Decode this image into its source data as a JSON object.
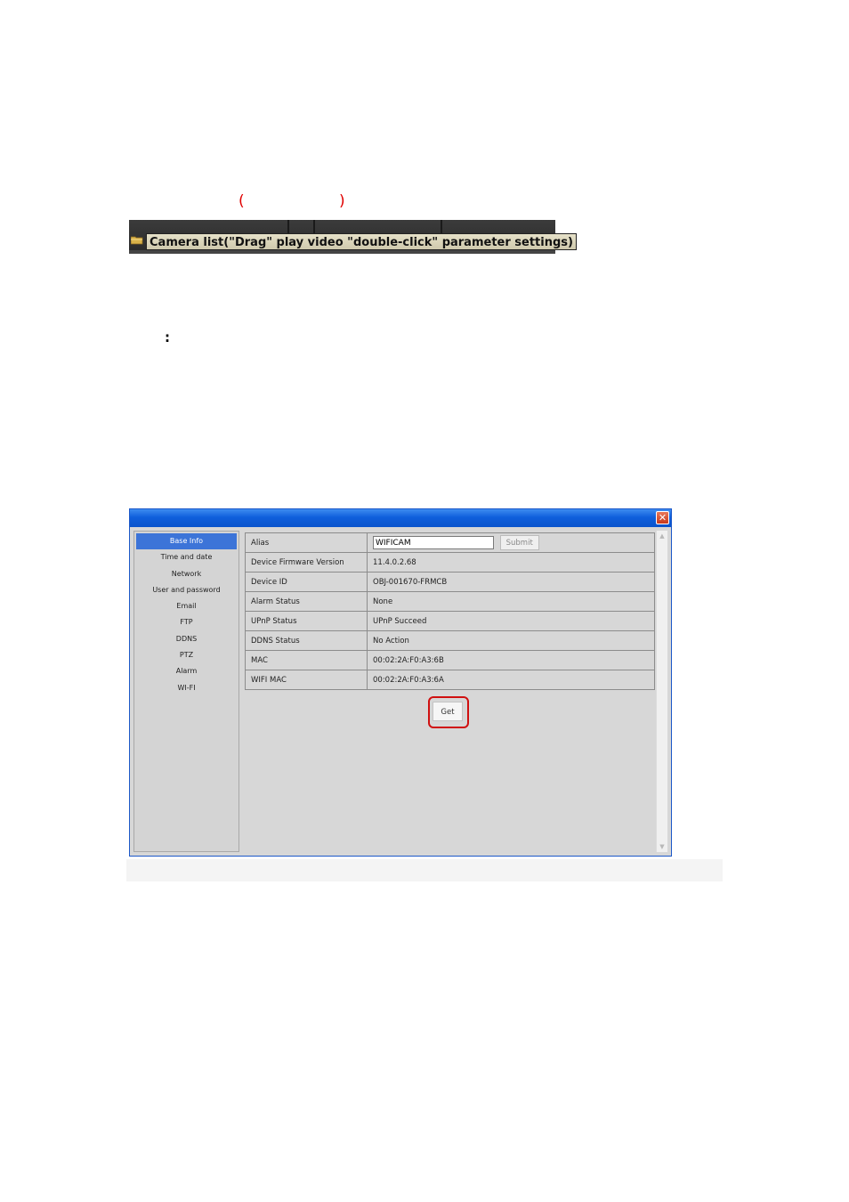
{
  "top_annotation": {
    "left_paren": "(",
    "right_paren": ")"
  },
  "camera_bar": {
    "label": "Camera list(\"Drag\" play video \"double-click\" parameter settings)",
    "icon": "folder-icon"
  },
  "colon_mark": ":",
  "dialog": {
    "close_icon": "close-icon",
    "close_glyph": "✕",
    "sidebar": {
      "items": [
        {
          "label": "Base Info"
        },
        {
          "label": "Time and date"
        },
        {
          "label": "Network"
        },
        {
          "label": "User and password"
        },
        {
          "label": "Email"
        },
        {
          "label": "FTP"
        },
        {
          "label": "DDNS"
        },
        {
          "label": "PTZ"
        },
        {
          "label": "Alarm"
        },
        {
          "label": "WI-FI"
        }
      ],
      "active": "Base Info"
    },
    "info": {
      "alias": {
        "label": "Alias",
        "value": "WIFICAM",
        "submit": "Submit"
      },
      "rows": [
        {
          "key": "Device Firmware Version",
          "value": "11.4.0.2.68"
        },
        {
          "key": "Device ID",
          "value": "OBJ-001670-FRMCB"
        },
        {
          "key": "Alarm Status",
          "value": "None"
        },
        {
          "key": "UPnP Status",
          "value": "UPnP Succeed"
        },
        {
          "key": "DDNS Status",
          "value": "No Action"
        },
        {
          "key": "MAC",
          "value": "00:02:2A:F0:A3:6B"
        },
        {
          "key": "WIFI MAC",
          "value": "00:02:2A:F0:A3:6A"
        }
      ]
    },
    "get_button": "Get",
    "colors": {
      "titlebar": "#0f5fdc",
      "highlight": "#d01010",
      "active_item": "#3c74d8"
    }
  }
}
